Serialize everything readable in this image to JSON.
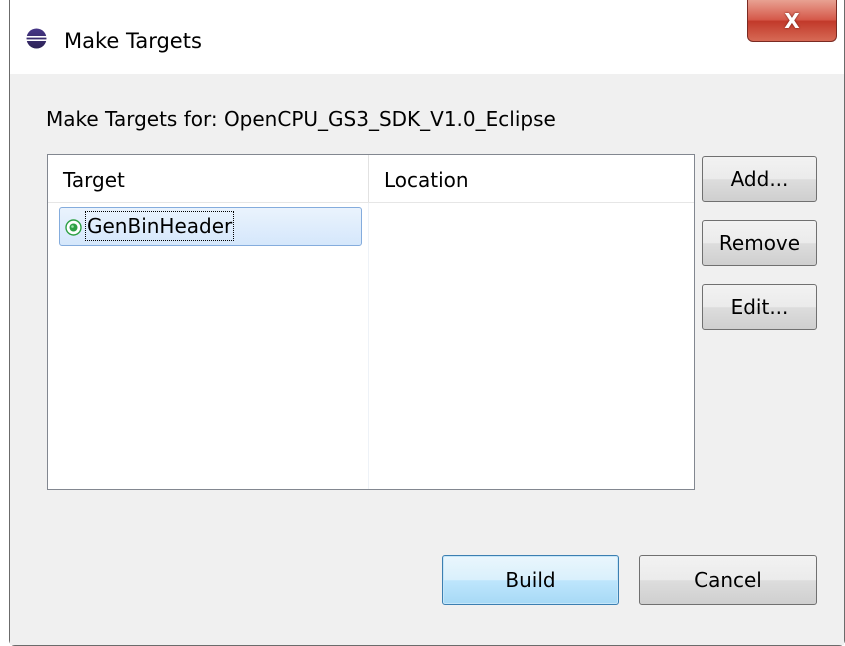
{
  "window": {
    "title": "Make Targets",
    "close_label": "X"
  },
  "heading": "Make Targets for: OpenCPU_GS3_SDK_V1.0_Eclipse",
  "table": {
    "columns": [
      "Target",
      "Location"
    ],
    "rows": [
      {
        "target": "GenBinHeader",
        "location": "",
        "selected": true
      }
    ]
  },
  "buttons": {
    "add": "Add...",
    "remove": "Remove",
    "edit": "Edit...",
    "build": "Build",
    "cancel": "Cancel"
  },
  "icons": {
    "app": "eclipse-icon",
    "row": "make-target-icon",
    "close": "close-icon"
  },
  "colors": {
    "close_button": "#c2392a",
    "default_button_border": "#3c7fb1",
    "selection_border": "#84acdd",
    "target_icon": "#2ea043"
  }
}
